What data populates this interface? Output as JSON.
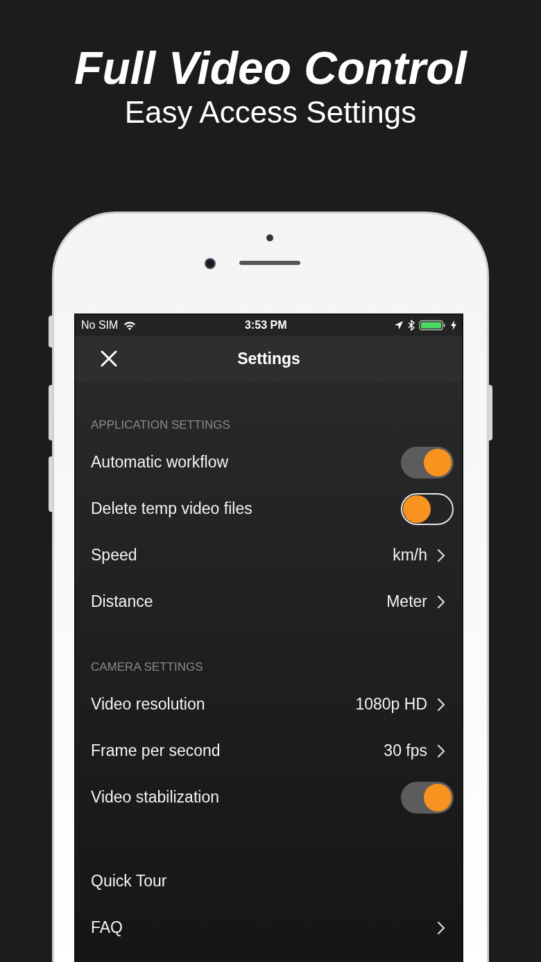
{
  "headline": "Full Video Control",
  "subheadline": "Easy Access Settings",
  "status_bar": {
    "carrier": "No SIM",
    "time": "3:53 PM"
  },
  "nav": {
    "title": "Settings"
  },
  "sections": [
    {
      "header": "APPLICATION SETTINGS",
      "items": [
        {
          "kind": "toggle",
          "label": "Automatic workflow",
          "on": true
        },
        {
          "kind": "toggle",
          "label": "Delete temp video files",
          "on": false
        },
        {
          "kind": "disclosure",
          "label": "Speed",
          "value": "km/h"
        },
        {
          "kind": "disclosure",
          "label": "Distance",
          "value": "Meter"
        }
      ]
    },
    {
      "header": "CAMERA SETTINGS",
      "items": [
        {
          "kind": "disclosure",
          "label": "Video resolution",
          "value": "1080p HD"
        },
        {
          "kind": "disclosure",
          "label": "Frame per second",
          "value": "30 fps"
        },
        {
          "kind": "toggle",
          "label": "Video stabilization",
          "on": true
        }
      ]
    },
    {
      "items": [
        {
          "kind": "link",
          "label": "Quick Tour"
        },
        {
          "kind": "disclosure",
          "label": "FAQ"
        }
      ]
    }
  ]
}
